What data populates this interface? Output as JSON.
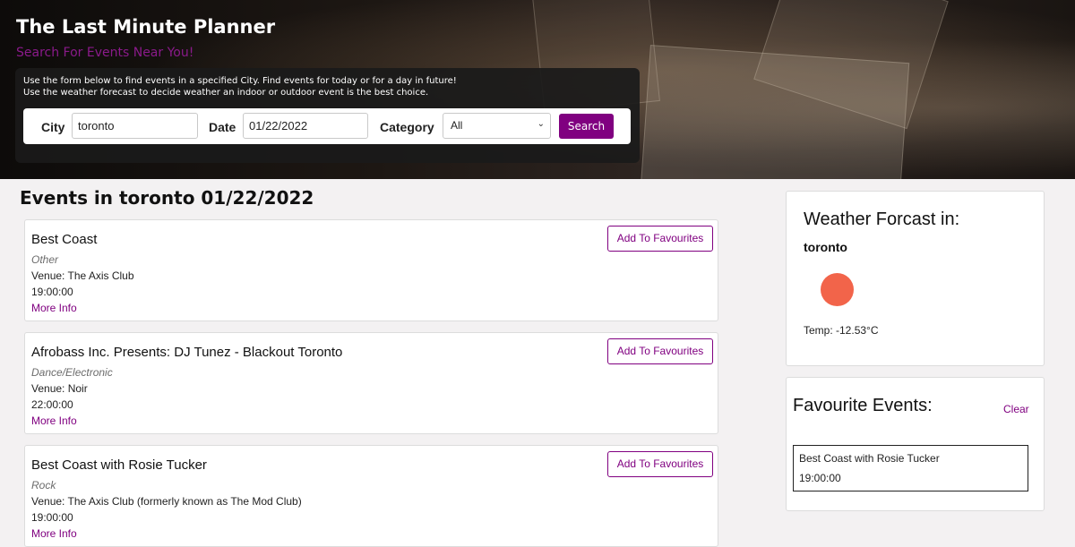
{
  "header": {
    "title": "The Last Minute Planner",
    "subtitle": "Search For Events Near You!",
    "intro_line1": "Use the form below to find events in a specified City. Find events for today or for a day in future!",
    "intro_line2": "Use the weather forecast to decide weather an indoor or outdoor event is the best choice."
  },
  "search": {
    "city_label": "City",
    "city_value": "toronto",
    "date_label": "Date",
    "date_value": "01/22/2022",
    "category_label": "Category",
    "category_selected": "All",
    "button_label": "Search"
  },
  "events": {
    "heading": "Events in toronto 01/22/2022",
    "fav_button_label": "Add To Favourites",
    "more_info_label": "More Info",
    "items": [
      {
        "title": "Best Coast",
        "genre": "Other",
        "venue": "Venue: The Axis Club",
        "time": "19:00:00"
      },
      {
        "title": "Afrobass Inc. Presents: DJ Tunez - Blackout Toronto",
        "genre": "Dance/Electronic",
        "venue": "Venue: Noir",
        "time": "22:00:00"
      },
      {
        "title": "Best Coast with Rosie Tucker",
        "genre": "Rock",
        "venue": "Venue: The Axis Club (formerly known as The Mod Club)",
        "time": "19:00:00"
      }
    ]
  },
  "weather": {
    "heading": "Weather Forcast in:",
    "city": "toronto",
    "icon": "sun-icon",
    "icon_color": "#f2644a",
    "temp": "Temp: -12.53°C"
  },
  "favourites": {
    "heading": "Favourite Events:",
    "clear_label": "Clear",
    "items": [
      {
        "title": "Best Coast with Rosie Tucker",
        "time": "19:00:00"
      }
    ]
  },
  "colors": {
    "accent": "#800080",
    "page_background": "#f3f1f2"
  }
}
